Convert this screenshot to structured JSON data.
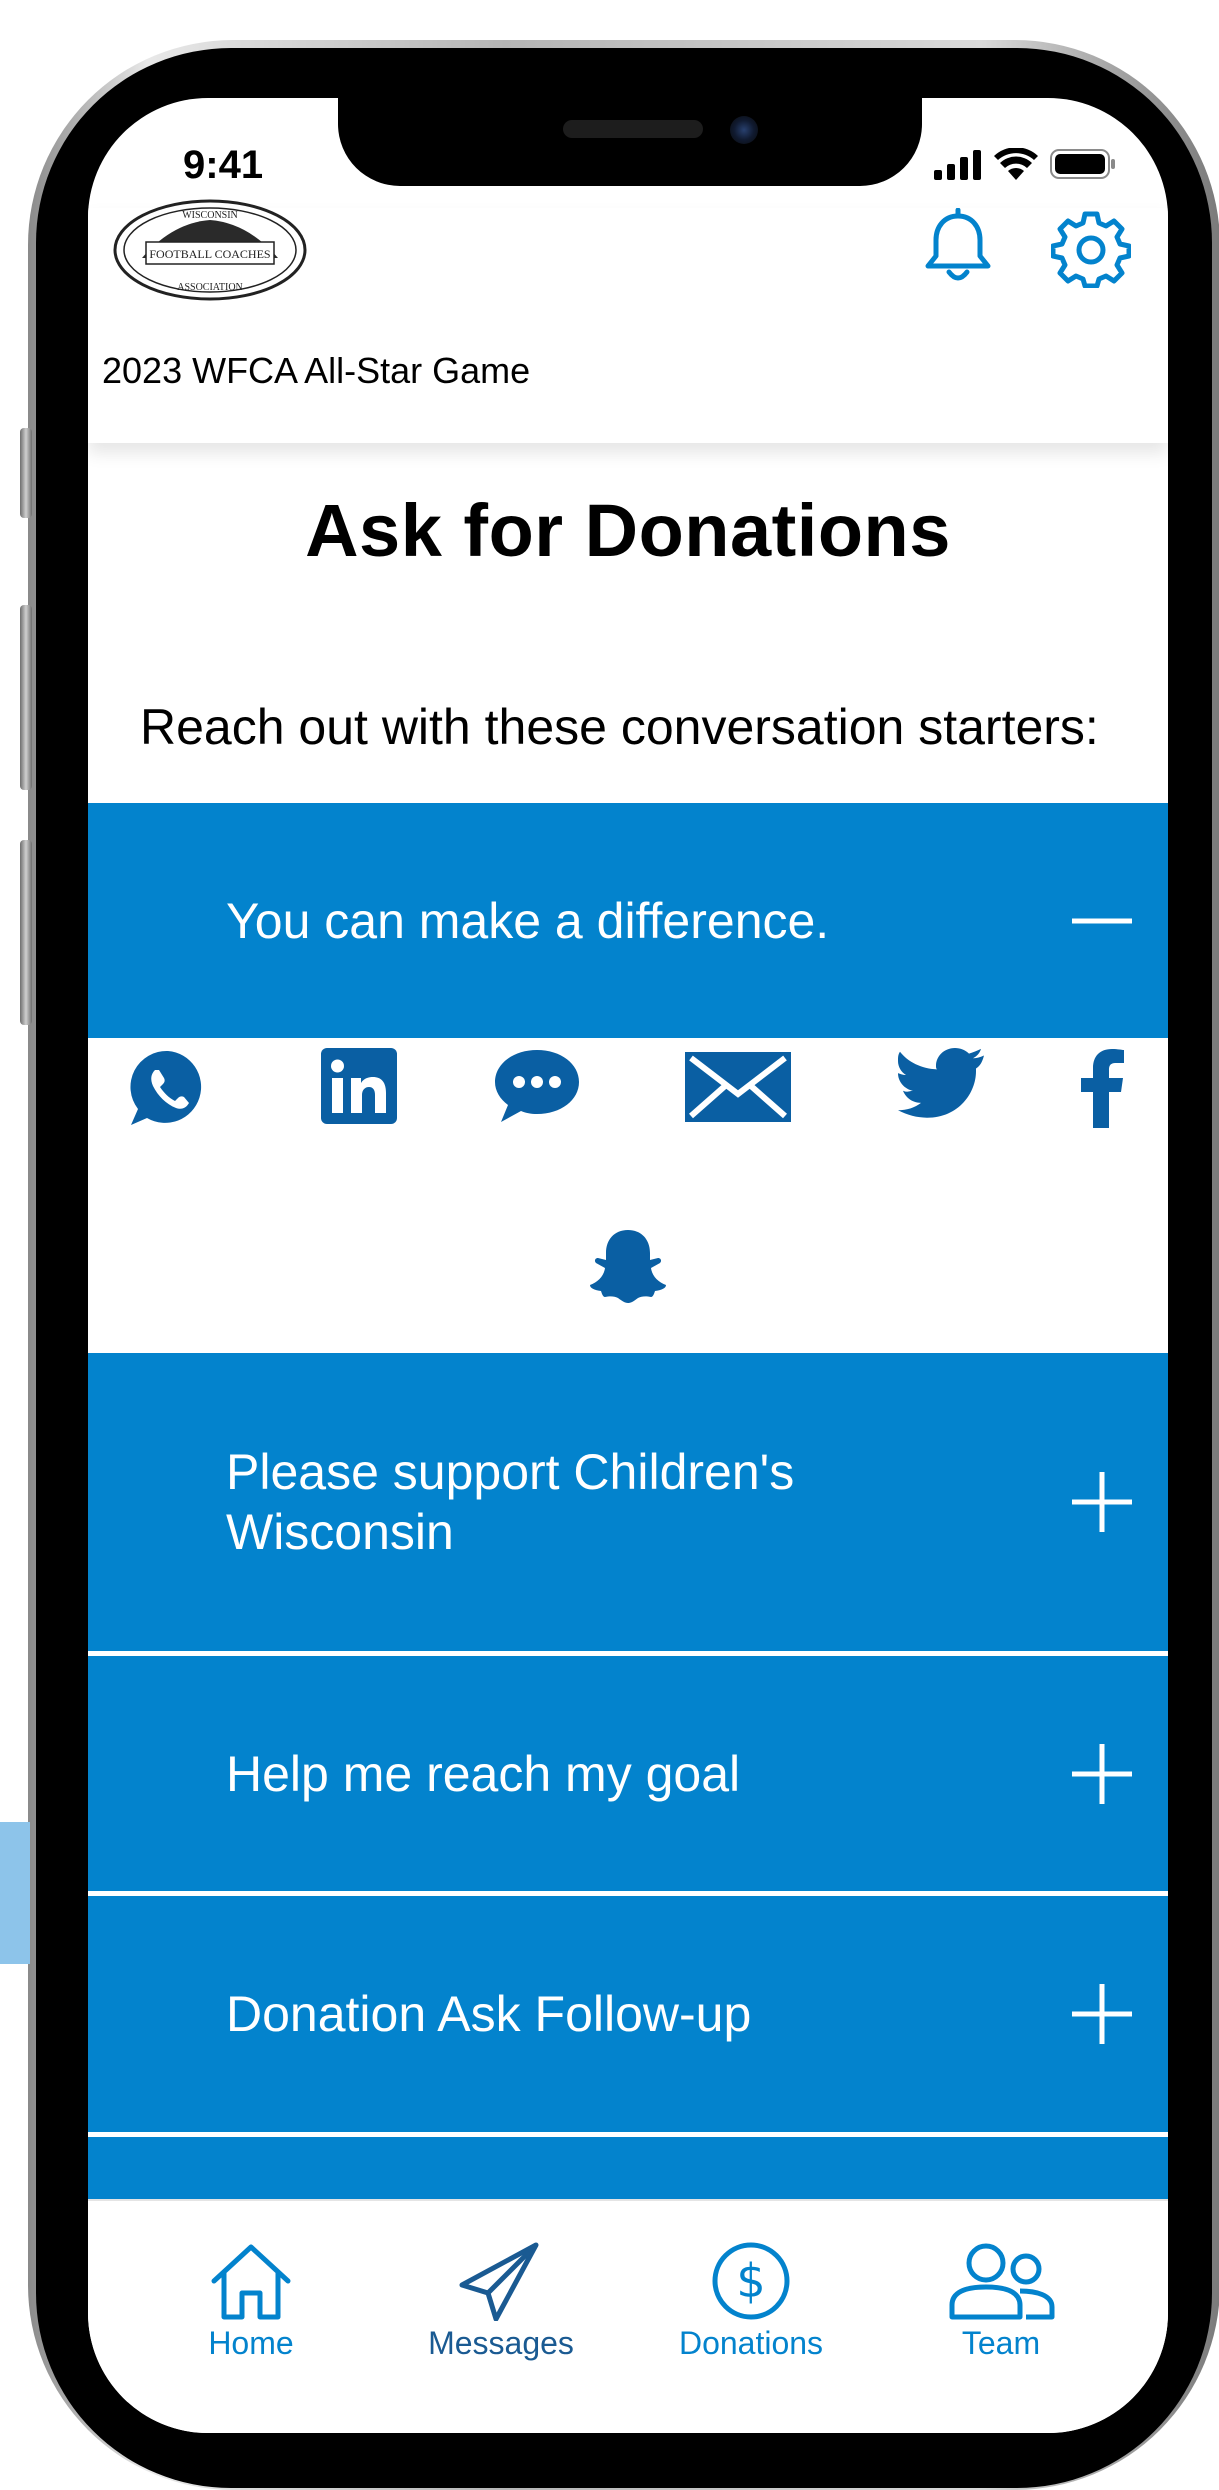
{
  "status_bar": {
    "time": "9:41"
  },
  "header": {
    "logo": {
      "text_top": "WISCONSIN",
      "text_middle": "FOOTBALL COACHES",
      "text_bottom": "ASSOCIATION"
    },
    "notification_icon": "bell-icon",
    "settings_icon": "gear-icon",
    "event_title": "2023 WFCA All-Star Game"
  },
  "page": {
    "title": "Ask for Donations",
    "subtitle": "Reach out with these conversation starters:"
  },
  "accordions": [
    {
      "label": "You can make a difference.",
      "expanded": true
    },
    {
      "label": "Please support Children's Wisconsin",
      "expanded": false
    },
    {
      "label": "Help me reach my goal",
      "expanded": false
    },
    {
      "label": "Donation Ask Follow-up",
      "expanded": false
    }
  ],
  "share_icons": [
    "whatsapp-icon",
    "linkedin-icon",
    "sms-icon",
    "email-icon",
    "twitter-icon",
    "facebook-icon",
    "snapchat-icon"
  ],
  "bottom_nav": [
    {
      "label": "Home",
      "icon": "home-icon"
    },
    {
      "label": "Messages",
      "icon": "paper-plane-icon",
      "active": true
    },
    {
      "label": "Donations",
      "icon": "dollar-icon"
    },
    {
      "label": "Team",
      "icon": "people-icon"
    }
  ],
  "colors": {
    "accent": "#0383cd",
    "icon_dark": "#0a5fa3",
    "active_nav": "#1a5a92"
  }
}
